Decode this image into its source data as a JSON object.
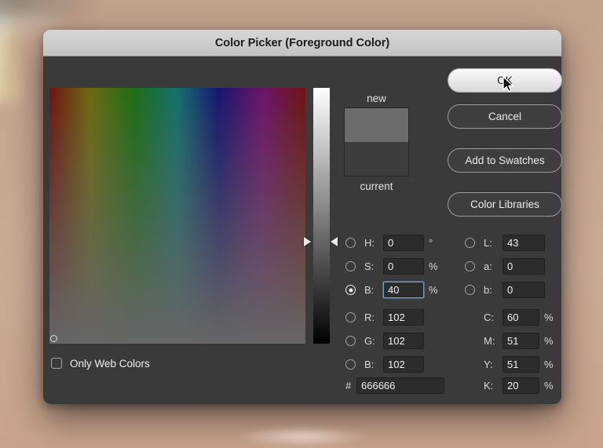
{
  "window": {
    "title": "Color Picker (Foreground Color)"
  },
  "preview": {
    "new_label": "new",
    "current_label": "current",
    "new_color": "#6c6c6c",
    "current_color": "#3d3d3d"
  },
  "buttons": {
    "ok": "OK",
    "cancel": "Cancel",
    "add_to_swatches": "Add to Swatches",
    "color_libraries": "Color Libraries"
  },
  "fields": {
    "h": {
      "label": "H:",
      "value": "0",
      "unit": "°"
    },
    "s": {
      "label": "S:",
      "value": "0",
      "unit": "%"
    },
    "b_hsb": {
      "label": "B:",
      "value": "40",
      "unit": "%"
    },
    "r": {
      "label": "R:",
      "value": "102"
    },
    "g": {
      "label": "G:",
      "value": "102"
    },
    "b_rgb": {
      "label": "B:",
      "value": "102"
    },
    "l": {
      "label": "L:",
      "value": "43"
    },
    "a": {
      "label": "a:",
      "value": "0"
    },
    "b_lab": {
      "label": "b:",
      "value": "0"
    },
    "c": {
      "label": "C:",
      "value": "60",
      "unit": "%"
    },
    "m": {
      "label": "M:",
      "value": "51",
      "unit": "%"
    },
    "y": {
      "label": "Y:",
      "value": "51",
      "unit": "%"
    },
    "k": {
      "label": "K:",
      "value": "20",
      "unit": "%"
    },
    "hex": {
      "label": "#",
      "value": "666666"
    }
  },
  "options": {
    "only_web_colors": "Only Web Colors"
  },
  "state": {
    "selected_radio": "B (HSB)",
    "brightness_percent": 40
  }
}
